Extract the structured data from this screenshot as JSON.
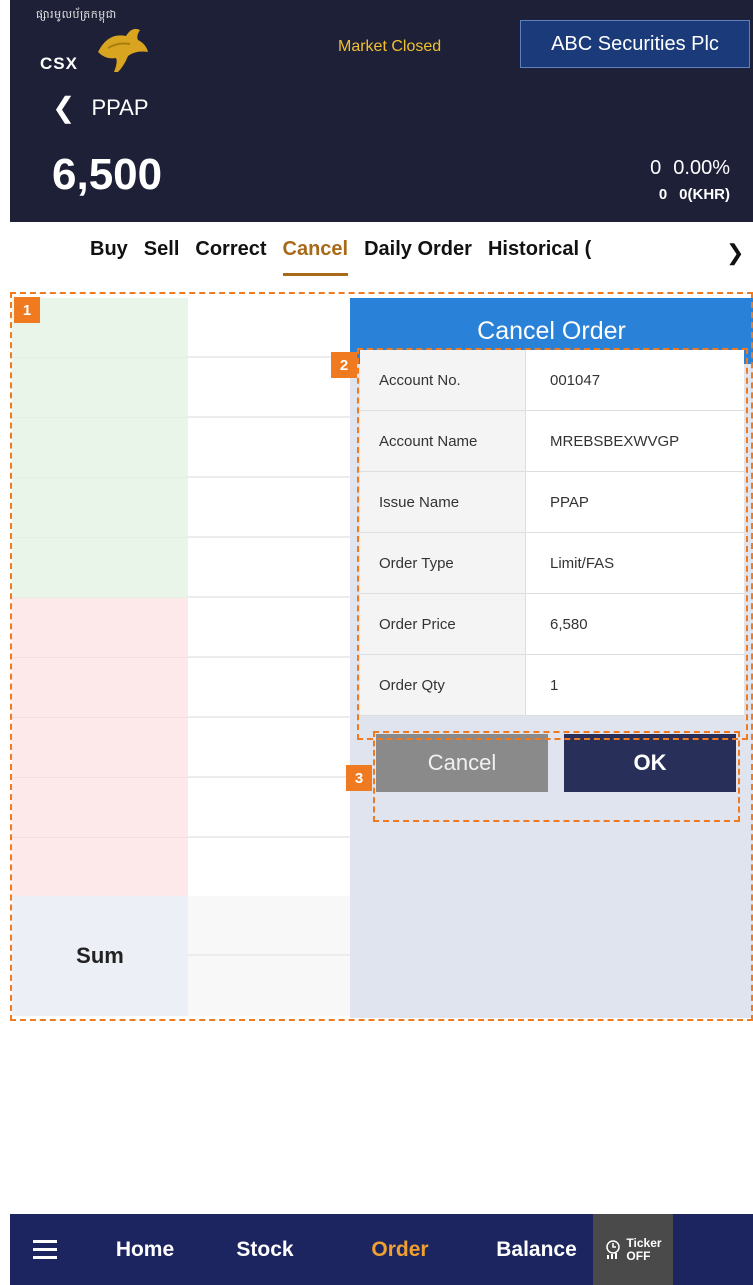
{
  "header": {
    "logo_script": "ផ្សារមូលប័ត្រកម្ពុជា",
    "logo_text": "CSX",
    "market_status": "Market Closed",
    "broker": "ABC Securities Plc",
    "symbol": "PPAP",
    "price": "6,500",
    "change": "0",
    "change_pct": "0.00%",
    "volume": "0",
    "value_khr": "0(KHR)"
  },
  "tabs": {
    "items": [
      "Buy",
      "Sell",
      "Correct",
      "Cancel",
      "Daily Order",
      "Historical ("
    ],
    "active": "Cancel"
  },
  "order_book": {
    "sum_label": "Sum"
  },
  "dialog": {
    "title": "Cancel Order",
    "rows": [
      {
        "label": "Account No.",
        "value": "001047"
      },
      {
        "label": "Account Name",
        "value": "MREBSBEXWVGP"
      },
      {
        "label": "Issue Name",
        "value": "PPAP"
      },
      {
        "label": "Order Type",
        "value": "Limit/FAS"
      },
      {
        "label": "Order Price",
        "value": "6,580"
      },
      {
        "label": "Order Qty",
        "value": "1"
      }
    ],
    "cancel_label": "Cancel",
    "ok_label": "OK"
  },
  "annotations": [
    "1",
    "2",
    "3"
  ],
  "bottom_nav": {
    "items": [
      "Home",
      "Stock",
      "Order",
      "Balance"
    ],
    "active": "Order",
    "ticker_label": "Ticker",
    "ticker_state": "OFF"
  },
  "colors": {
    "header_bg": "#1e2038",
    "accent_gold": "#a86a18",
    "dialog_title": "#2a82d8",
    "ok_button": "#28305a",
    "nav_bg": "#1c2560",
    "annotation": "#f07a20"
  }
}
